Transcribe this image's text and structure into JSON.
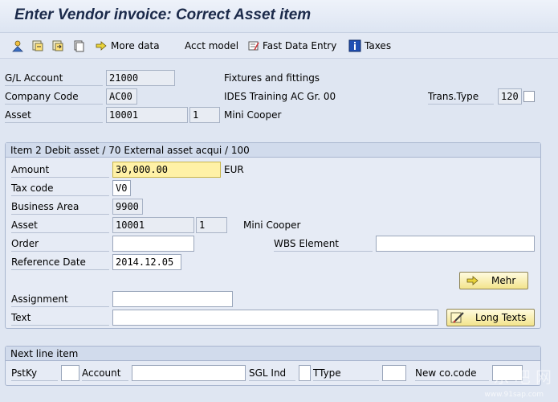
{
  "window": {
    "title": "Enter Vendor invoice: Correct Asset item"
  },
  "toolbar": {
    "more_data": "More data",
    "acct_model": "Acct model",
    "fast_data_entry": "Fast Data Entry",
    "taxes": "Taxes"
  },
  "header": {
    "gl_account_label": "G/L Account",
    "gl_account_value": "21000",
    "gl_account_desc": "Fixtures and fittings",
    "company_code_label": "Company Code",
    "company_code_value": "AC00",
    "company_code_desc": "IDES Training AC Gr. 00",
    "trans_type_label": "Trans.Type",
    "trans_type_value": "120",
    "asset_label": "Asset",
    "asset_value": "10001",
    "asset_sub": "1",
    "asset_desc": "Mini Cooper"
  },
  "item": {
    "title": "Item 2 Debit asset / 70 External asset acqui / 100",
    "amount_label": "Amount",
    "amount_value": "30,000.00",
    "currency": "EUR",
    "tax_code_label": "Tax code",
    "tax_code_value": "V0",
    "business_area_label": "Business Area",
    "business_area_value": "9900",
    "asset_label": "Asset",
    "asset_value": "10001",
    "asset_sub": "1",
    "asset_desc": "Mini Cooper",
    "order_label": "Order",
    "order_value": "",
    "wbs_label": "WBS Element",
    "wbs_value": "",
    "ref_date_label": "Reference Date",
    "ref_date_value": "2014.12.05",
    "mehr_button": "Mehr",
    "assignment_label": "Assignment",
    "assignment_value": "",
    "text_label": "Text",
    "text_value": "",
    "long_texts_button": "Long Texts"
  },
  "next_line": {
    "title": "Next line item",
    "pstky_label": "PstKy",
    "account_label": "Account",
    "sgl_ind_label": "SGL Ind",
    "ttype_label": "TType",
    "new_cocode_label": "New co.code"
  },
  "watermark": {
    "text": "东 吧 网",
    "url": "www.91sap.com"
  },
  "colors": {
    "highlight": "#fff1a6",
    "background": "#dfe6f2"
  },
  "icons": [
    "person-icon",
    "copy-icon",
    "paste-icon",
    "document-icon",
    "arrow-right-icon",
    "fast-entry-icon",
    "info-icon"
  ]
}
